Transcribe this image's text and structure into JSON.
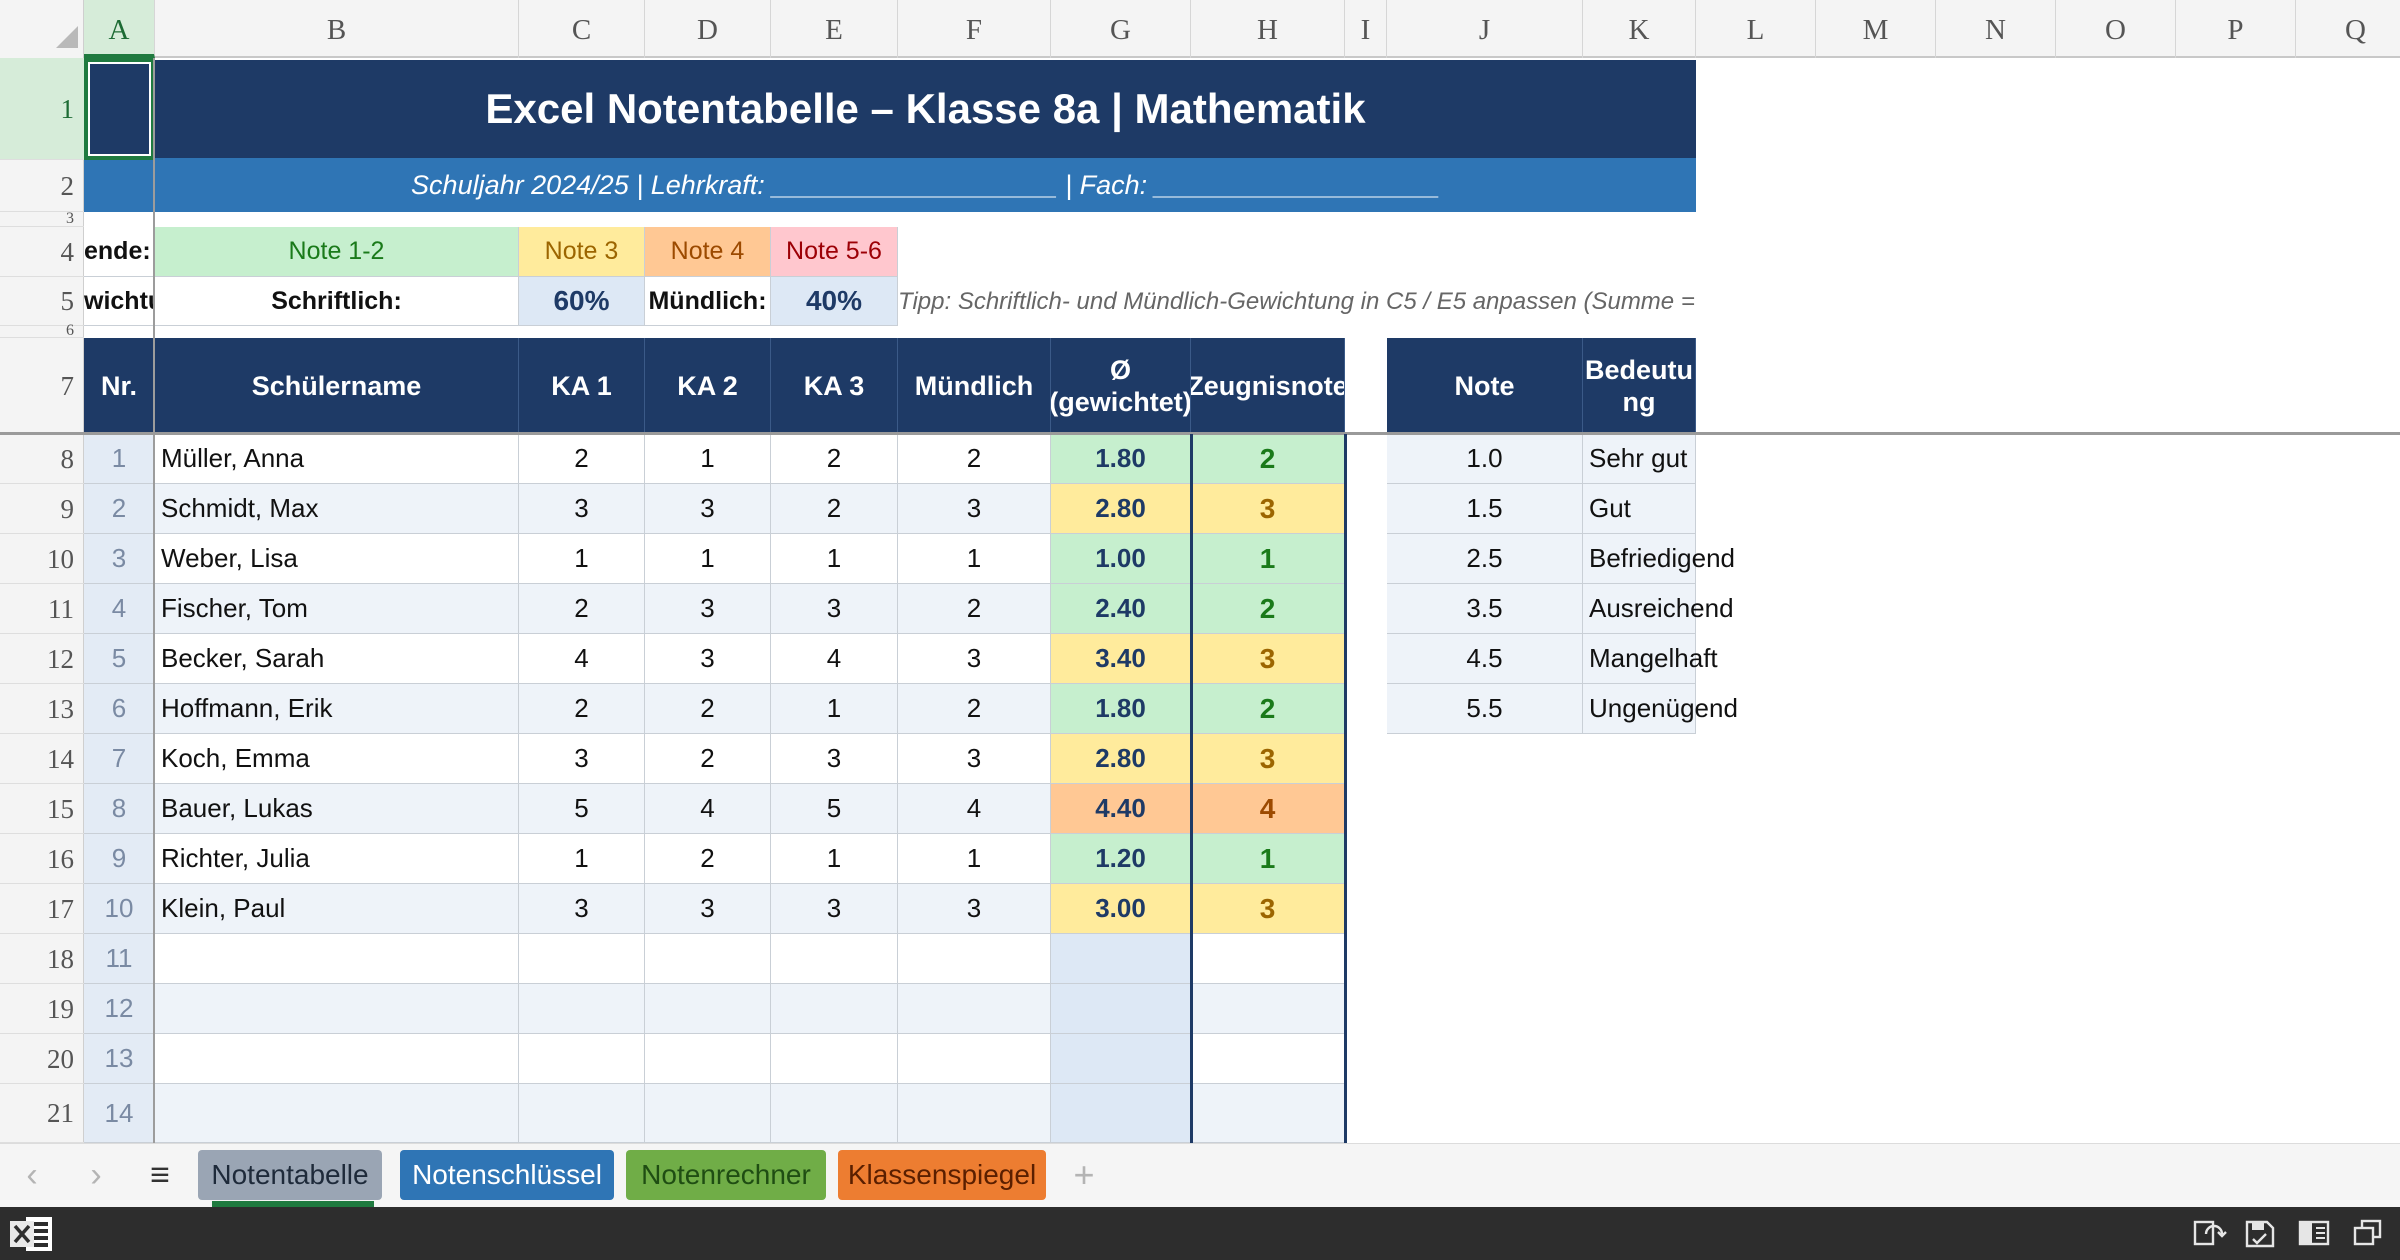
{
  "columns": [
    "A",
    "B",
    "C",
    "D",
    "E",
    "F",
    "G",
    "H",
    "I",
    "J",
    "K",
    "L",
    "M",
    "N",
    "O",
    "P",
    "Q"
  ],
  "selected_column": "A",
  "rows": [
    "1",
    "2",
    "3",
    "4",
    "5",
    "6",
    "7",
    "8",
    "9",
    "10",
    "11",
    "12",
    "13",
    "14",
    "15",
    "16",
    "17",
    "18",
    "19",
    "20",
    "21"
  ],
  "selected_row": "1",
  "header": {
    "title": "Excel Notentabelle – Klasse 8a  |  Mathematik",
    "subtitle": "Schuljahr 2024/25  |  Lehrkraft: ___________________  |  Fach: ___________________"
  },
  "legend": {
    "label": "ende:",
    "items": [
      {
        "text": "Note 1-2",
        "bg": "#c6efce",
        "fg": "#1a7a1a"
      },
      {
        "text": "Note 3",
        "bg": "#ffeb9c",
        "fg": "#9c6500"
      },
      {
        "text": "Note 4",
        "bg": "#ffc894",
        "fg": "#9c4a00"
      },
      {
        "text": "Note 5-6",
        "bg": "#ffc7ce",
        "fg": "#9c0006"
      }
    ]
  },
  "weights": {
    "label": "wichtu",
    "written_label": "Schriftlich:",
    "written_pct": "60%",
    "oral_label": "Mündlich:",
    "oral_pct": "40%",
    "tip": "Tipp: Schriftlich- und Mündlich-Gewichtung in C5 / E5 anpassen (Summe ="
  },
  "table": {
    "headers": {
      "nr": "Nr.",
      "name": "Schülername",
      "ka1": "KA 1",
      "ka2": "KA 2",
      "ka3": "KA 3",
      "oral": "Mündlich",
      "avg": "Ø (gewichtet)",
      "grade": "Zeugnisnote"
    },
    "students": [
      {
        "nr": "1",
        "name": "Müller, Anna",
        "ka1": "2",
        "ka2": "1",
        "ka3": "2",
        "oral": "2",
        "avg": "1.80",
        "grade": "2",
        "band": "good"
      },
      {
        "nr": "2",
        "name": "Schmidt, Max",
        "ka1": "3",
        "ka2": "3",
        "ka3": "2",
        "oral": "3",
        "avg": "2.80",
        "grade": "3",
        "band": "mid"
      },
      {
        "nr": "3",
        "name": "Weber, Lisa",
        "ka1": "1",
        "ka2": "1",
        "ka3": "1",
        "oral": "1",
        "avg": "1.00",
        "grade": "1",
        "band": "good"
      },
      {
        "nr": "4",
        "name": "Fischer, Tom",
        "ka1": "2",
        "ka2": "3",
        "ka3": "3",
        "oral": "2",
        "avg": "2.40",
        "grade": "2",
        "band": "good"
      },
      {
        "nr": "5",
        "name": "Becker, Sarah",
        "ka1": "4",
        "ka2": "3",
        "ka3": "4",
        "oral": "3",
        "avg": "3.40",
        "grade": "3",
        "band": "mid"
      },
      {
        "nr": "6",
        "name": "Hoffmann, Erik",
        "ka1": "2",
        "ka2": "2",
        "ka3": "1",
        "oral": "2",
        "avg": "1.80",
        "grade": "2",
        "band": "good"
      },
      {
        "nr": "7",
        "name": "Koch, Emma",
        "ka1": "3",
        "ka2": "2",
        "ka3": "3",
        "oral": "3",
        "avg": "2.80",
        "grade": "3",
        "band": "mid"
      },
      {
        "nr": "8",
        "name": "Bauer, Lukas",
        "ka1": "5",
        "ka2": "4",
        "ka3": "5",
        "oral": "4",
        "avg": "4.40",
        "grade": "4",
        "band": "low"
      },
      {
        "nr": "9",
        "name": "Richter, Julia",
        "ka1": "1",
        "ka2": "2",
        "ka3": "1",
        "oral": "1",
        "avg": "1.20",
        "grade": "1",
        "band": "good"
      },
      {
        "nr": "10",
        "name": "Klein, Paul",
        "ka1": "3",
        "ka2": "3",
        "ka3": "3",
        "oral": "3",
        "avg": "3.00",
        "grade": "3",
        "band": "mid"
      },
      {
        "nr": "11",
        "name": "",
        "ka1": "",
        "ka2": "",
        "ka3": "",
        "oral": "",
        "avg": "",
        "grade": "",
        "band": "empty"
      },
      {
        "nr": "12",
        "name": "",
        "ka1": "",
        "ka2": "",
        "ka3": "",
        "oral": "",
        "avg": "",
        "grade": "",
        "band": "empty"
      },
      {
        "nr": "13",
        "name": "",
        "ka1": "",
        "ka2": "",
        "ka3": "",
        "oral": "",
        "avg": "",
        "grade": "",
        "band": "empty"
      },
      {
        "nr": "14",
        "name": "",
        "ka1": "",
        "ka2": "",
        "ka3": "",
        "oral": "",
        "avg": "",
        "grade": "",
        "band": "empty"
      }
    ]
  },
  "band_colors": {
    "good": {
      "bg": "#c6efce",
      "fg": "#1a7a1a"
    },
    "mid": {
      "bg": "#ffeb9c",
      "fg": "#9c6500"
    },
    "low": {
      "bg": "#ffc894",
      "fg": "#9c4a00"
    },
    "empty": {
      "bg": "#dde8f5",
      "fg": "#1e3a66"
    }
  },
  "key": {
    "headers": {
      "note": "Note",
      "meaning": "Bedeutu ng"
    },
    "rows": [
      {
        "note": "1.0",
        "meaning": "Sehr gut"
      },
      {
        "note": "1.5",
        "meaning": "Gut"
      },
      {
        "note": "2.5",
        "meaning": "Befriedigend"
      },
      {
        "note": "3.5",
        "meaning": "Ausreichend"
      },
      {
        "note": "4.5",
        "meaning": "Mangelhaft"
      },
      {
        "note": "5.5",
        "meaning": "Ungenügend"
      }
    ]
  },
  "tabs": [
    {
      "label": "Notentabelle",
      "bg": "#9aa5b4",
      "fg": "#1e2a3a",
      "active": true
    },
    {
      "label": "Notenschlüssel",
      "bg": "#2f75b5",
      "fg": "#ffffff"
    },
    {
      "label": "Notenrechner",
      "bg": "#70ad47",
      "fg": "#1f4d13"
    },
    {
      "label": "Klassenspiegel",
      "bg": "#ed7d31",
      "fg": "#5a1f00"
    }
  ],
  "tabbar": {
    "prev_icon": "‹",
    "next_icon": "›",
    "menu_icon": "≡",
    "add_icon": "+"
  },
  "statusbar_icons": [
    "excel-logo-icon",
    "sync-icon",
    "save-icon",
    "sidebar-icon",
    "restore-window-icon"
  ]
}
